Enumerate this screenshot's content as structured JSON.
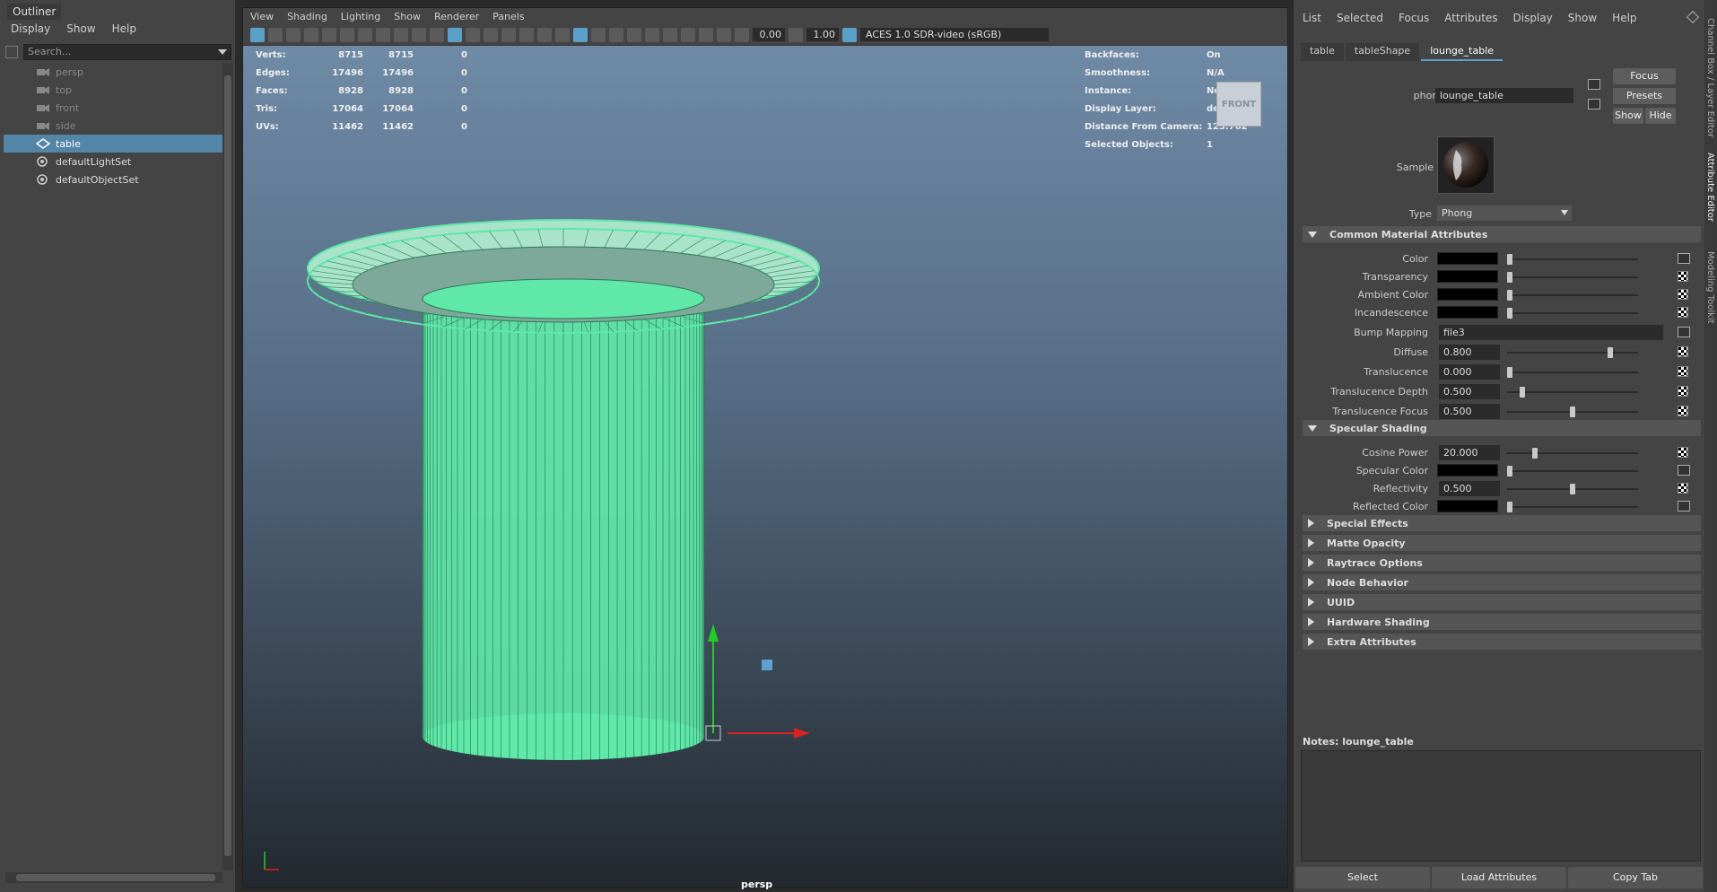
{
  "outliner": {
    "title": "Outliner",
    "menu": [
      "Display",
      "Show",
      "Help"
    ],
    "search_placeholder": "Search...",
    "items": [
      {
        "label": "persp",
        "icon": "camera-icon",
        "dim": true
      },
      {
        "label": "top",
        "icon": "camera-icon",
        "dim": true
      },
      {
        "label": "front",
        "icon": "camera-icon",
        "dim": true
      },
      {
        "label": "side",
        "icon": "camera-icon",
        "dim": true
      },
      {
        "label": "table",
        "icon": "transform-icon",
        "selected": true
      },
      {
        "label": "defaultLightSet",
        "icon": "set-icon"
      },
      {
        "label": "defaultObjectSet",
        "icon": "set-icon"
      }
    ]
  },
  "viewport": {
    "menu": [
      "View",
      "Shading",
      "Lighting",
      "Show",
      "Renderer",
      "Panels"
    ],
    "exposure": "0.00",
    "gamma": "1.00",
    "color_management": "ACES 1.0 SDR-video (sRGB)",
    "camera_label": "persp",
    "view_cube": "FRONT",
    "hud_left": [
      {
        "k": "Verts:",
        "a": "8715",
        "b": "8715",
        "c": "0"
      },
      {
        "k": "Edges:",
        "a": "17496",
        "b": "17496",
        "c": "0"
      },
      {
        "k": "Faces:",
        "a": "8928",
        "b": "8928",
        "c": "0"
      },
      {
        "k": "Tris:",
        "a": "17064",
        "b": "17064",
        "c": "0"
      },
      {
        "k": "UVs:",
        "a": "11462",
        "b": "11462",
        "c": "0"
      }
    ],
    "hud_right": [
      {
        "k": "Backfaces:",
        "v": "On"
      },
      {
        "k": "Smoothness:",
        "v": "N/A"
      },
      {
        "k": "Instance:",
        "v": "No"
      },
      {
        "k": "Display Layer:",
        "v": "default"
      },
      {
        "k": "Distance From Camera:",
        "v": "123.762"
      },
      {
        "k": "Selected Objects:",
        "v": "1"
      }
    ],
    "wire_color": "#5fe8a8"
  },
  "attr": {
    "menu": [
      "List",
      "Selected",
      "Focus",
      "Attributes",
      "Display",
      "Show",
      "Help"
    ],
    "tabs": [
      "table",
      "tableShape",
      "lounge_table"
    ],
    "node_type_label": "phong:",
    "node_name": "lounge_table",
    "buttons": {
      "focus": "Focus",
      "presets": "Presets",
      "show": "Show",
      "hide": "Hide"
    },
    "sample_label": "Sample",
    "type_label": "Type",
    "type_value": "Phong",
    "common_section": "Common Material Attributes",
    "color_rows": [
      {
        "label": "Color"
      },
      {
        "label": "Transparency"
      },
      {
        "label": "Ambient Color"
      },
      {
        "label": "Incandescence"
      }
    ],
    "bump_label": "Bump Mapping",
    "bump_value": "file3",
    "value_rows": [
      {
        "label": "Diffuse",
        "value": "0.800",
        "level": 0.8
      },
      {
        "label": "Translucence",
        "value": "0.000",
        "level": 0.0
      },
      {
        "label": "Translucence Depth",
        "value": "0.500",
        "level": 0.1
      },
      {
        "label": "Translucence Focus",
        "value": "0.500",
        "level": 0.5
      }
    ],
    "specular_section": "Specular Shading",
    "cosine_label": "Cosine Power",
    "cosine_value": "20.000",
    "cosine_level": 0.2,
    "spec_color_label": "Specular Color",
    "reflectivity_label": "Reflectivity",
    "reflectivity_value": "0.500",
    "reflectivity_level": 0.5,
    "reflected_label": "Reflected Color",
    "closed_sections": [
      "Special Effects",
      "Matte Opacity",
      "Raytrace Options",
      "Node Behavior",
      "UUID",
      "Hardware Shading",
      "Extra Attributes"
    ],
    "notes_label": "Notes:  lounge_table",
    "bottom_buttons": [
      "Select",
      "Load Attributes",
      "Copy Tab"
    ]
  },
  "side_tabs": [
    "Channel Box / Layer Editor",
    "Attribute Editor",
    "Modeling Toolkit"
  ]
}
